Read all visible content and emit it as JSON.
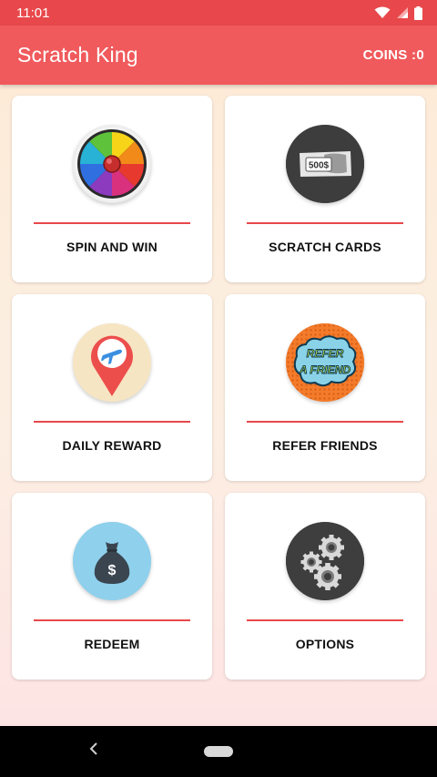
{
  "status_bar": {
    "time": "11:01",
    "icons": [
      "wifi-icon",
      "signal-icon",
      "battery-icon"
    ]
  },
  "app_bar": {
    "title": "Scratch King",
    "coins": "COINS :0"
  },
  "cards": [
    {
      "label": "SPIN AND WIN",
      "icon": "spin-wheel-icon"
    },
    {
      "label": "SCRATCH CARDS",
      "icon": "scratch-card-icon",
      "icon_text": "500$"
    },
    {
      "label": "DAILY REWARD",
      "icon": "map-pin-plane-icon"
    },
    {
      "label": "REFER FRIENDS",
      "icon": "refer-a-friend-icon",
      "icon_text_1": "REFER",
      "icon_text_2": "A FRIEND"
    },
    {
      "label": "REDEEM",
      "icon": "money-bag-icon",
      "icon_text": "$"
    },
    {
      "label": "OPTIONS",
      "icon": "gears-icon"
    }
  ],
  "colors": {
    "status_bar": "#e8484b",
    "app_bar": "#f05a5c",
    "accent_line": "#e8484b",
    "background_top": "#fdebd8",
    "background_bottom": "#fde4e4"
  },
  "nav_bar": {
    "icons": [
      "back-icon",
      "home-pill-icon"
    ]
  }
}
